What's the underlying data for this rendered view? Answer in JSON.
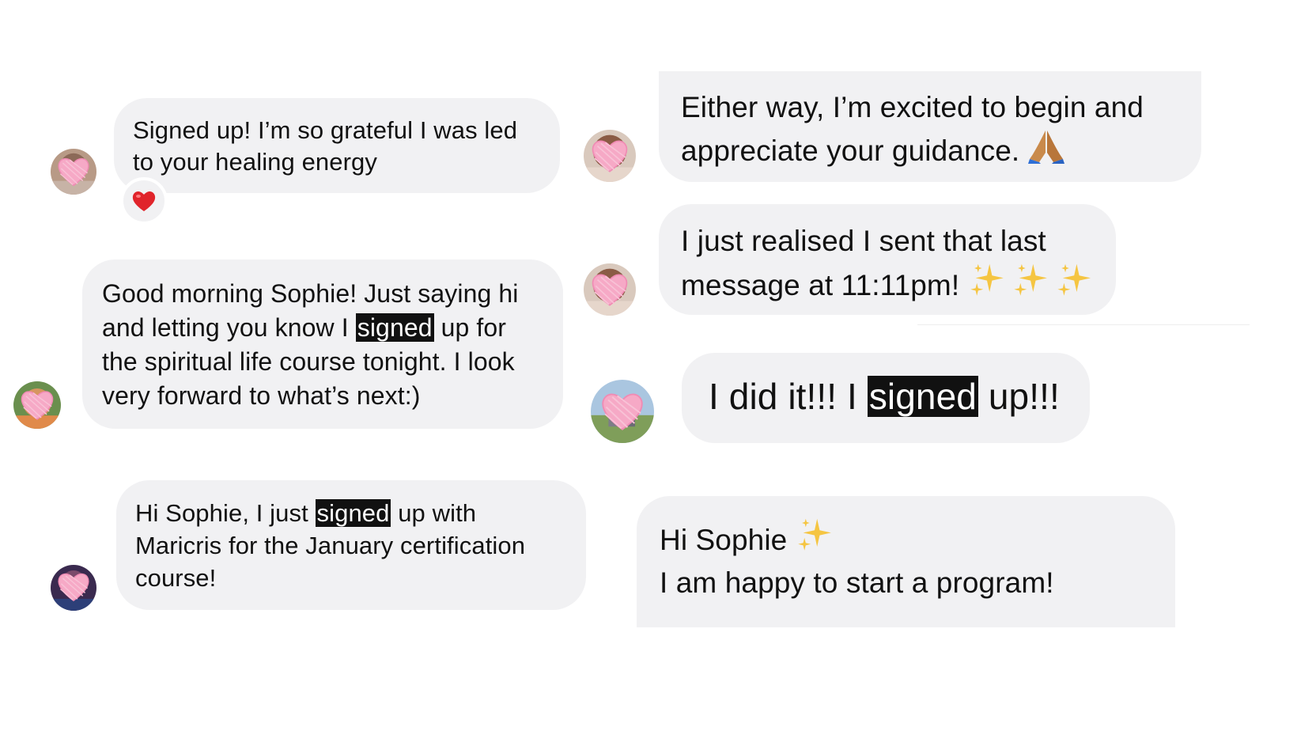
{
  "left_column": {
    "messages": [
      {
        "text": "Signed up! I’m so grateful I was led to your healing energy",
        "reaction": "red-heart-icon"
      },
      {
        "before": "Good morning Sophie! Just saying hi and letting you know I ",
        "highlight": "signed",
        "after": " up for the spiritual life course tonight. I look very forward to what’s next:)"
      },
      {
        "before": "Hi Sophie, I just ",
        "highlight": "signed",
        "after": " up with Maricris for the January certification course!"
      }
    ]
  },
  "right_column": {
    "messages": [
      {
        "text": "Either way, I’m excited to begin and appreciate your guidance.",
        "emoji": "folded-hands-icon"
      },
      {
        "text": "I just realised I sent that last message at 11:11pm!",
        "emoji": "sparkles-icon"
      },
      {
        "before": "I did it!!! I ",
        "highlight": "signed",
        "after": " up!!!"
      },
      {
        "line1": "Hi Sophie",
        "line2": "I am happy to start a program!",
        "emoji": "sparkles-icon"
      }
    ]
  },
  "colors": {
    "bubble": "#f1f1f3",
    "text": "#111111",
    "highlight_bg": "#111111",
    "highlight_text": "#ffffff",
    "heart_overlay": "#f6a9c6",
    "reaction_heart": "#e0242b",
    "sparkle": "#f5c542"
  }
}
